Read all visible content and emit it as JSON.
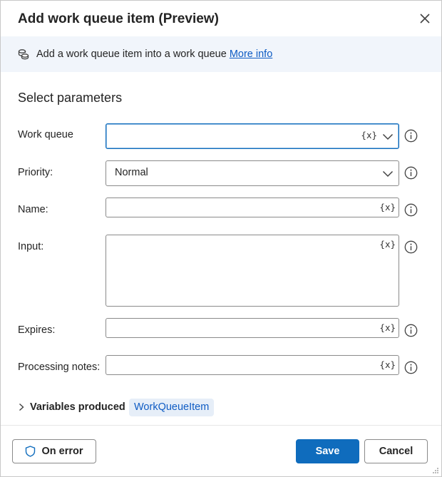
{
  "dialog": {
    "title": "Add work queue item (Preview)"
  },
  "banner": {
    "text": "Add a work queue item into a work queue",
    "link": "More info"
  },
  "section": {
    "title": "Select parameters"
  },
  "fields": {
    "work_queue": {
      "label": "Work queue",
      "value": "",
      "var_button": "{x}"
    },
    "priority": {
      "label": "Priority:",
      "value": "Normal"
    },
    "name": {
      "label": "Name:",
      "value": "",
      "var_button": "{x}"
    },
    "input": {
      "label": "Input:",
      "value": "",
      "var_button": "{x}"
    },
    "expires": {
      "label": "Expires:",
      "value": "",
      "var_button": "{x}"
    },
    "processing_notes": {
      "label": "Processing notes:",
      "value": "",
      "var_button": "{x}"
    }
  },
  "variables": {
    "label": "Variables produced",
    "items": [
      "WorkQueueItem"
    ]
  },
  "footer": {
    "on_error": "On error",
    "save": "Save",
    "cancel": "Cancel"
  },
  "colors": {
    "accent": "#0f6cbd",
    "banner_bg": "#f1f5fb",
    "chip_bg": "#e6eef8",
    "link": "#0f5cc4"
  }
}
